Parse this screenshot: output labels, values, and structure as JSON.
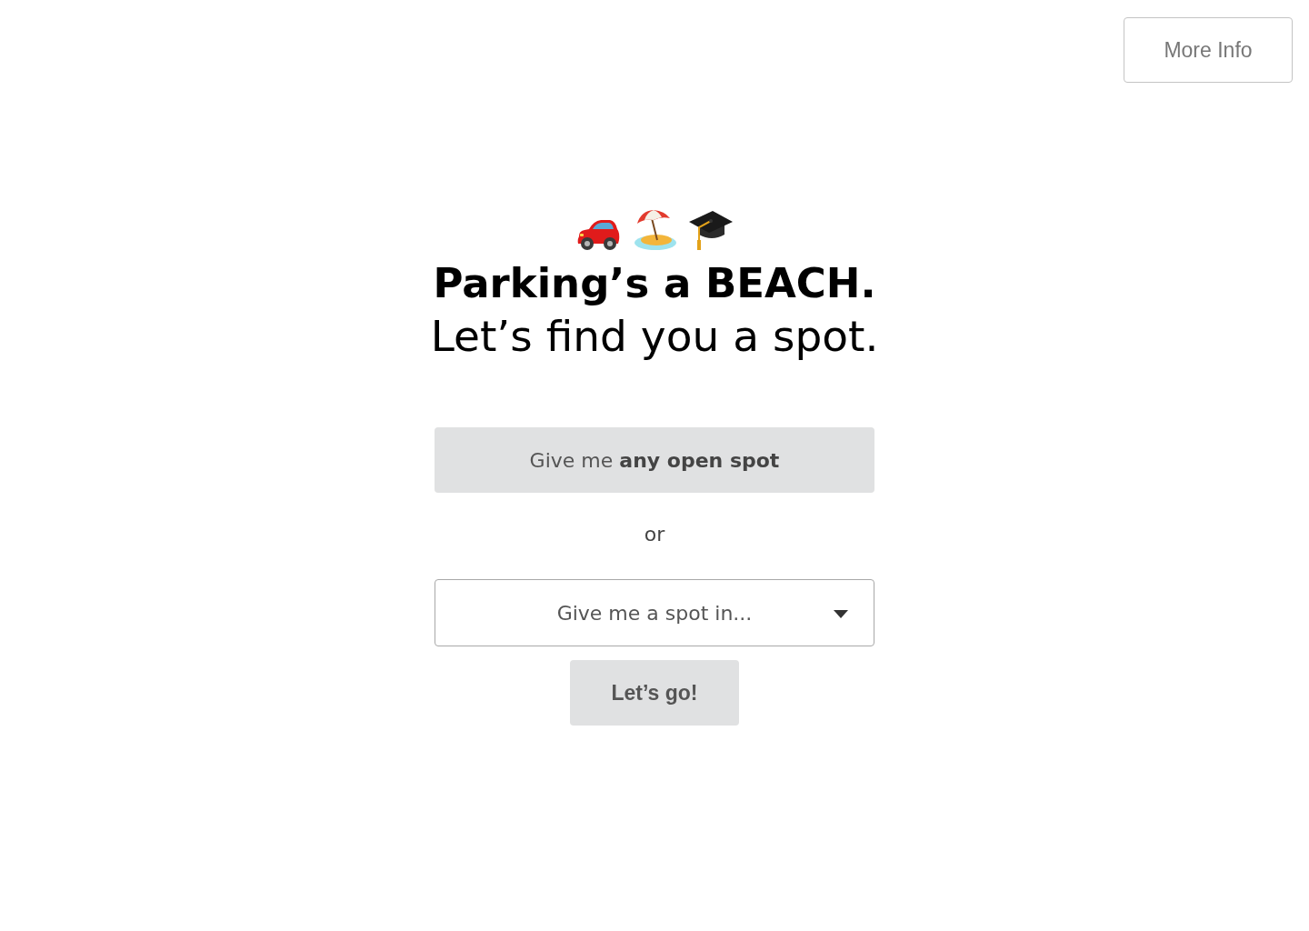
{
  "header": {
    "more_info_button": "More Info"
  },
  "hero": {
    "title": "Parking’s a BEACH.",
    "subtitle": "Let’s find you a spot."
  },
  "any_spot_button": "Give me **any open spot**",
  "separator": "or",
  "location_dropdown": {
    "placeholder": "Give me a spot in..."
  },
  "go_button": "Let’s go!"
}
